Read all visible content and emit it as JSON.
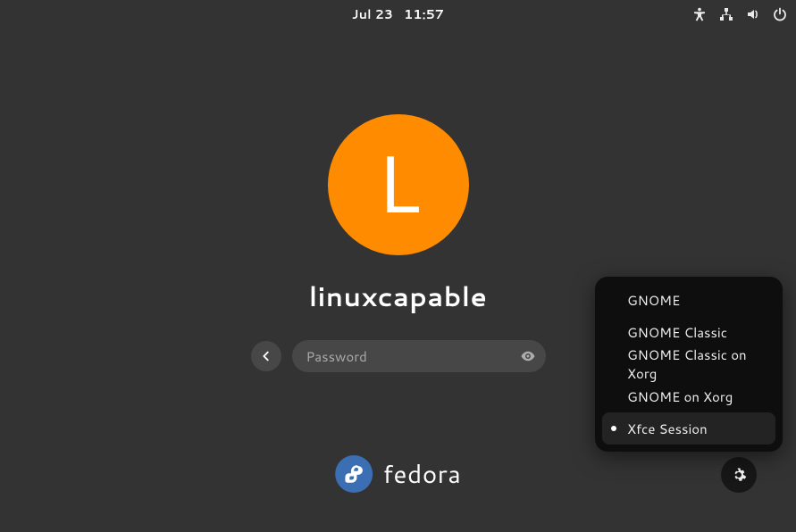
{
  "topbar": {
    "date": "Jul 23",
    "time": "11:57",
    "tray": {
      "accessibility": "accessibility",
      "network": "wired-network",
      "volume": "volume",
      "power": "power"
    }
  },
  "login": {
    "avatar_initial": "L",
    "avatar_color": "#ff8c00",
    "username": "linuxcapable",
    "password_placeholder": "Password",
    "password_value": ""
  },
  "sessions": {
    "items": [
      {
        "label": "GNOME",
        "selected": false
      },
      {
        "label": "GNOME Classic",
        "selected": false
      },
      {
        "label": "GNOME Classic on Xorg",
        "selected": false
      },
      {
        "label": "GNOME on Xorg",
        "selected": false
      },
      {
        "label": "Xfce Session",
        "selected": true
      }
    ]
  },
  "distro": {
    "name": "fedora",
    "logo": "fedora-logo"
  }
}
